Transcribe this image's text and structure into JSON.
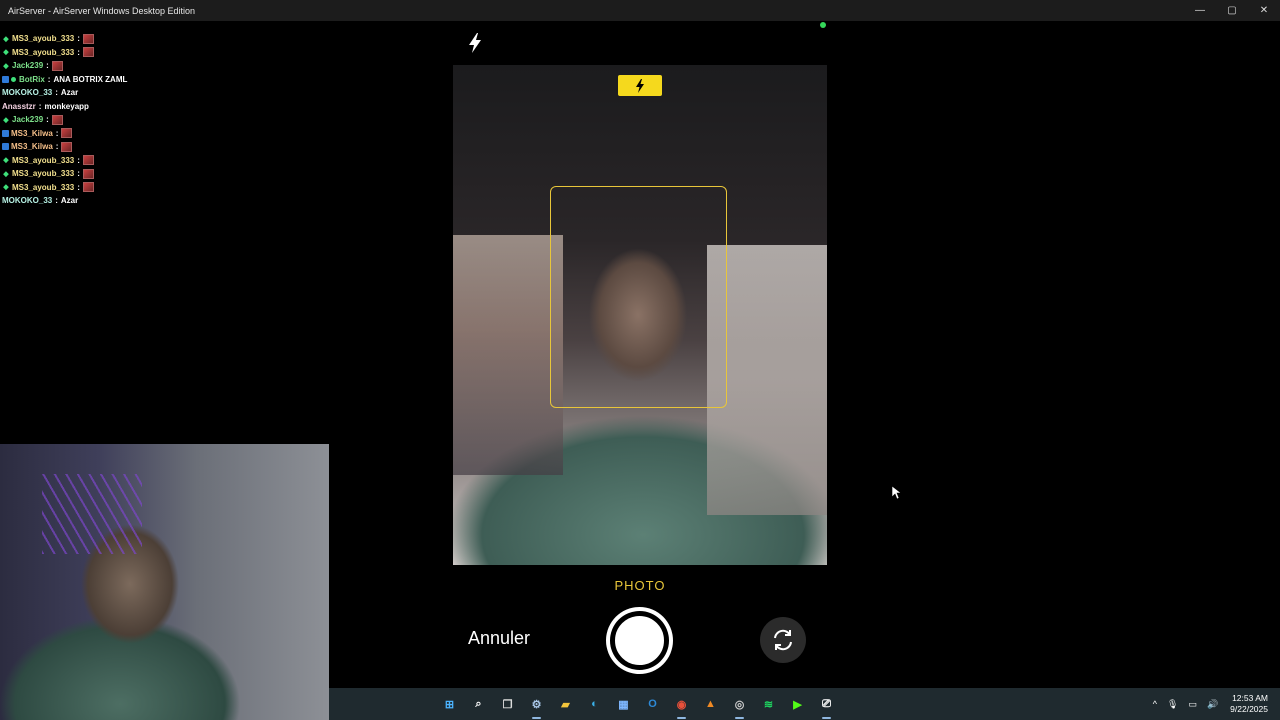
{
  "window": {
    "title": "AirServer - AirServer Windows Desktop Edition",
    "controls": {
      "minimize": "—",
      "maximize": "▢",
      "close": "✕"
    }
  },
  "chat": [
    {
      "badge": "vip",
      "user": "MS3_ayoub_333",
      "sep": ":",
      "message": "",
      "emote": true,
      "color": "u-yellow"
    },
    {
      "badge": "vip",
      "user": "MS3_ayoub_333",
      "sep": ":",
      "message": "",
      "emote": true,
      "color": "u-yellow"
    },
    {
      "badge": "vip",
      "user": "Jack239",
      "sep": ":",
      "message": "",
      "emote": true,
      "color": "u-green"
    },
    {
      "badge": "mod",
      "dot": true,
      "user": "BotRix",
      "sep": ":",
      "message": "ANA BOTRIX ZAML",
      "emote": false,
      "color": "u-green"
    },
    {
      "badge": "none",
      "user": "MOKOKO_33",
      "sep": ":",
      "message": "Azar",
      "emote": false,
      "color": "u-teal"
    },
    {
      "badge": "none",
      "user": "Anasstzr",
      "sep": ":",
      "message": "monkeyapp",
      "emote": false,
      "color": "u-pink"
    },
    {
      "badge": "vip",
      "user": "Jack239",
      "sep": ":",
      "message": "",
      "emote": true,
      "color": "u-green"
    },
    {
      "badge": "mod",
      "user": "MS3_Kilwa",
      "sep": ":",
      "message": "",
      "emote": true,
      "color": "u-orange"
    },
    {
      "badge": "mod",
      "user": "MS3_Kilwa",
      "sep": ":",
      "message": "",
      "emote": true,
      "color": "u-orange"
    },
    {
      "badge": "vip",
      "user": "MS3_ayoub_333",
      "sep": ":",
      "message": "",
      "emote": true,
      "color": "u-yellow"
    },
    {
      "badge": "vip",
      "user": "MS3_ayoub_333",
      "sep": ":",
      "message": "",
      "emote": true,
      "color": "u-yellow"
    },
    {
      "badge": "vip",
      "user": "MS3_ayoub_333",
      "sep": ":",
      "message": "",
      "emote": true,
      "color": "u-yellow"
    },
    {
      "badge": "none",
      "user": "MOKOKO_33",
      "sep": ":",
      "message": "Azar",
      "emote": false,
      "color": "u-teal"
    }
  ],
  "camera": {
    "mode_label": "PHOTO",
    "cancel_label": "Annuler",
    "flash_state": "on",
    "accent_color": "#e8c63a"
  },
  "taskbar": {
    "icons": [
      {
        "name": "windows-start-icon",
        "glyph": "⊞",
        "color": "#4cb4ff",
        "active": false
      },
      {
        "name": "search-icon",
        "glyph": "⌕",
        "color": "#ffffff",
        "active": false
      },
      {
        "name": "task-view-icon",
        "glyph": "❐",
        "color": "#dddddd",
        "active": false
      },
      {
        "name": "settings-icon",
        "glyph": "⚙",
        "color": "#a9c7e8",
        "active": true
      },
      {
        "name": "file-explorer-icon",
        "glyph": "▰",
        "color": "#f3c53c",
        "active": false
      },
      {
        "name": "edge-icon",
        "glyph": "◐",
        "color": "#3ab0e8",
        "active": false
      },
      {
        "name": "store-icon",
        "glyph": "▦",
        "color": "#7fb8ff",
        "active": false
      },
      {
        "name": "outlook-icon",
        "glyph": "O",
        "color": "#2d8ad8",
        "active": false
      },
      {
        "name": "chrome-icon",
        "glyph": "◉",
        "color": "#e8503a",
        "active": true
      },
      {
        "name": "vlc-icon",
        "glyph": "▲",
        "color": "#f08a24",
        "active": false
      },
      {
        "name": "obs-icon",
        "glyph": "◎",
        "color": "#cccccc",
        "active": true
      },
      {
        "name": "spotify-icon",
        "glyph": "≋",
        "color": "#1ed760",
        "active": false
      },
      {
        "name": "kick-icon",
        "glyph": "▶",
        "color": "#53fc18",
        "active": false
      },
      {
        "name": "airserver-icon",
        "glyph": "⎚",
        "color": "#ffffff",
        "active": true
      }
    ],
    "tray": {
      "chevron": "^",
      "mic": "🎙",
      "network": "▭",
      "volume": "🔊",
      "time": "12:53 AM",
      "date": "9/22/2025"
    }
  }
}
